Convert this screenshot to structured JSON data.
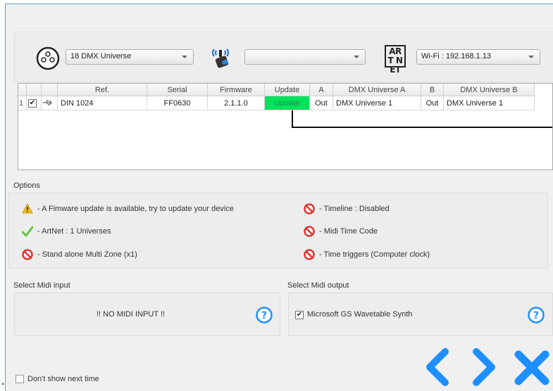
{
  "top": {
    "universe_select": "18 DMX Universe",
    "wireless_select": "",
    "network_select": "Wi-Fi : 192.168.1.13",
    "artnet_logo": "ART NET"
  },
  "table": {
    "headers": [
      "",
      "",
      "",
      "Ref.",
      "Serial",
      "Firmware",
      "Update",
      "A",
      "DMX Universe A",
      "B",
      "DMX Universe B"
    ],
    "row": {
      "index": "1",
      "checked": "✔",
      "ref": "DIN 1024",
      "serial": "FF0630",
      "firmware": "2.1.1.0",
      "update": "Update",
      "a": "Out",
      "dmx_a": "DMX Universe 1",
      "b": "Out",
      "dmx_b": "DMX Universe 1"
    }
  },
  "options": {
    "title": "Options",
    "items": [
      {
        "icon": "warning-icon",
        "text": "- A Fimware update is available, try to update your device"
      },
      {
        "icon": "check-icon",
        "text": "- ArtNet : 1 Universes"
      },
      {
        "icon": "prohibited-icon",
        "text": "- Stand alone Multi Zone (x1)"
      },
      {
        "icon": "prohibited-icon",
        "text": "- Timeline : Disabled"
      },
      {
        "icon": "prohibited-icon",
        "text": "- Midi Time Code"
      },
      {
        "icon": "prohibited-icon",
        "text": "- Time triggers (Computer clock)"
      }
    ]
  },
  "midi": {
    "input_label": "Select Midi input",
    "input_value": "!! NO MIDI INPUT !!",
    "output_label": "Select Midi output",
    "output_value": "Microsoft GS Wavetable Synth",
    "output_checked": "✔"
  },
  "footer": {
    "dont_show": "Don't show next time"
  },
  "colors": {
    "accent_blue": "#1e90ff",
    "update_green": "#00e25c"
  }
}
